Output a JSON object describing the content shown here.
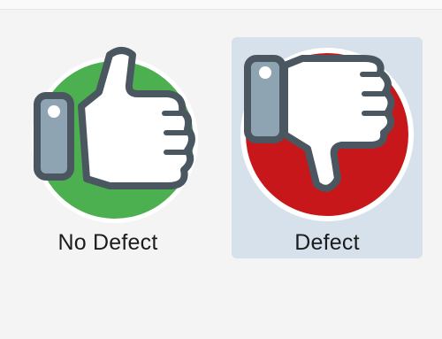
{
  "options": [
    {
      "id": "no-defect",
      "label": "No Defect",
      "icon": "thumbs-up-icon",
      "circle_color": "#4caf50",
      "selected": false
    },
    {
      "id": "defect",
      "label": "Defect",
      "icon": "thumbs-down-icon",
      "circle_color": "#c8171a",
      "selected": true
    }
  ],
  "colors": {
    "selection_background": "#d6e1ec",
    "outline": "#4a5660",
    "cuff": "#8fa4b3"
  }
}
